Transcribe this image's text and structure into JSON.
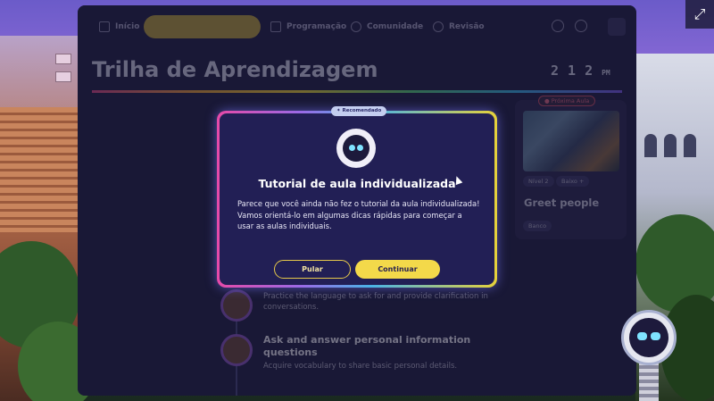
{
  "nav": {
    "items": [
      {
        "label": "Início",
        "icon": "home-icon"
      },
      {
        "label": "Programação",
        "icon": "calendar-icon"
      },
      {
        "label": "Comunidade",
        "icon": "community-icon"
      },
      {
        "label": "Revisão",
        "icon": "search-icon"
      }
    ]
  },
  "page": {
    "title": "Trilha de Aprendizagem",
    "clock": {
      "digits": [
        "2",
        "1",
        "2"
      ],
      "ampm": "PM"
    }
  },
  "lessons": [
    {
      "title": "",
      "description": "Practice the language to ask for and provide clarification in conversations."
    },
    {
      "title": "Ask and answer personal information questions",
      "description": "Acquire vocabulary to share basic personal details."
    }
  ],
  "next_lesson": {
    "badge": "Próxima Aula",
    "level": "Nível 2",
    "intensity": "Baixo +",
    "title": "Greet people",
    "topic": "Banco"
  },
  "modal": {
    "badge": "Recomendado",
    "title": "Tutorial de aula individualizada",
    "body": "Parece que você ainda não fez o tutorial da aula individualizada! Vamos orientá-lo em algumas dicas rápidas para começar a usar as aulas individuais.",
    "skip_label": "Pular",
    "continue_label": "Continuar"
  },
  "top_right_button": {
    "icon": "fullscreen-icon",
    "glyph": "⤢"
  },
  "colors": {
    "panel": "#232248",
    "modal": "#221f55",
    "accent_yellow": "#f3d94a",
    "badge_red": "#e06a86"
  }
}
